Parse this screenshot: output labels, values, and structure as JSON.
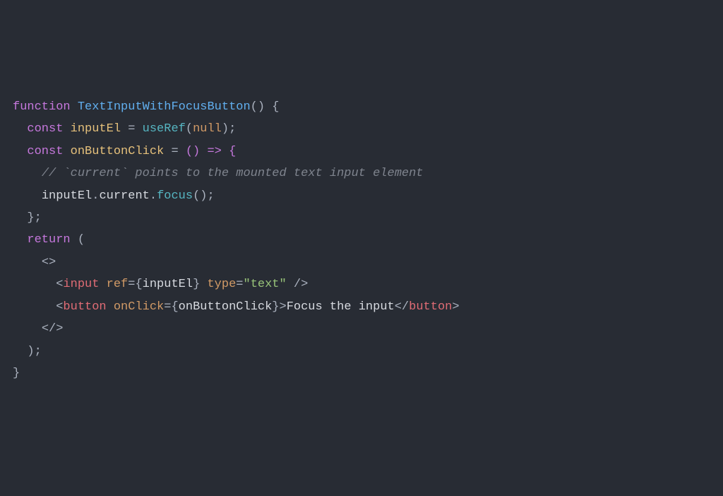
{
  "code": {
    "l1_kw_function": "function",
    "l1_fn_name": "TextInputWithFocusButton",
    "l1_paren_brace": "() {",
    "l2_indent": "  ",
    "l2_kw_const": "const",
    "l2_var": "inputEl",
    "l2_eq": " = ",
    "l2_call": "useRef",
    "l2_arg_open": "(",
    "l2_null": "null",
    "l2_arg_close": ");",
    "l3_indent": "  ",
    "l3_kw_const": "const",
    "l3_var": "onButtonClick",
    "l3_eq": " = ",
    "l3_arrow": "() => {",
    "l4_indent": "    ",
    "l4_comment": "// `current` points to the mounted text input element",
    "l5_indent": "    ",
    "l5_obj": "inputEl",
    "l5_dot1": ".",
    "l5_prop": "current",
    "l5_dot2": ".",
    "l5_method": "focus",
    "l5_call": "();",
    "l6_indent": "  ",
    "l6_close": "};",
    "l7_indent": "  ",
    "l7_return": "return",
    "l7_paren": " (",
    "l8_indent": "    ",
    "l8_frag_open": "<>",
    "l9_indent": "      ",
    "l9_lt": "<",
    "l9_tag": "input",
    "l9_sp1": " ",
    "l9_attr1": "ref",
    "l9_eq1": "=",
    "l9_brace_o1": "{",
    "l9_val1": "inputEl",
    "l9_brace_c1": "}",
    "l9_sp2": " ",
    "l9_attr2": "type",
    "l9_eq2": "=",
    "l9_str": "\"text\"",
    "l9_close": " />",
    "l10_indent": "      ",
    "l10_lt": "<",
    "l10_tag": "button",
    "l10_sp": " ",
    "l10_attr": "onClick",
    "l10_eq": "=",
    "l10_brace_o": "{",
    "l10_val": "onButtonClick",
    "l10_brace_c": "}",
    "l10_gt": ">",
    "l10_text": "Focus the input",
    "l10_ctag_o": "</",
    "l10_ctag": "button",
    "l10_ctag_c": ">",
    "l11_indent": "    ",
    "l11_frag_close": "</>",
    "l12_indent": "  ",
    "l12_paren_close": ");",
    "l13_brace": "}"
  }
}
